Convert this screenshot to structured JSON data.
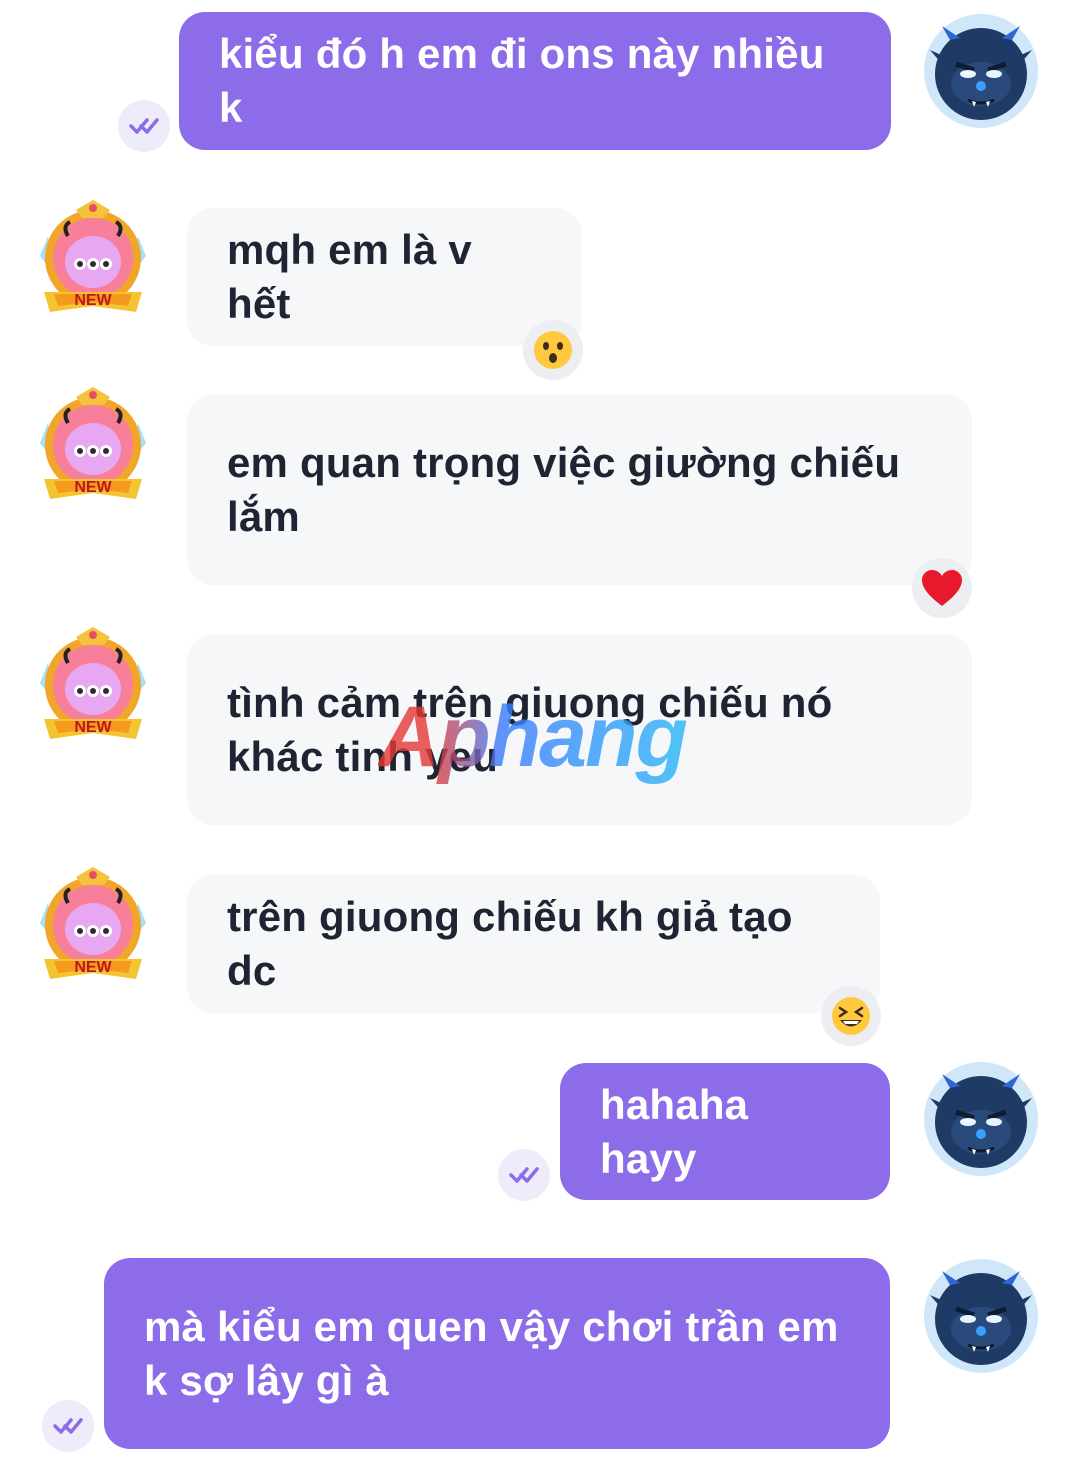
{
  "messages": [
    {
      "text": "kiểu đó h em đi ons này nhiều k",
      "dir": "out"
    },
    {
      "text": "mqh em là v hết",
      "dir": "in",
      "reaction": "surprised-face"
    },
    {
      "text": "em quan trọng việc giường chiếu lắm",
      "dir": "in",
      "reaction": "red-heart"
    },
    {
      "text": "tình cảm trên giuong chiếu nó khác tinh yeu",
      "dir": "in"
    },
    {
      "text": "trên giuong chiếu kh giả tạo dc",
      "dir": "in",
      "reaction": "laughing-face"
    },
    {
      "text": "hahaha hayy",
      "dir": "out"
    },
    {
      "text": "mà kiểu em quen vậy chơi trần em k sợ lây gì à",
      "dir": "out"
    }
  ],
  "watermark": {
    "text": "Aphang"
  },
  "colors": {
    "outgoing_bubble": "#8c6ce9",
    "incoming_bubble": "#f6f7f9",
    "outgoing_text": "#ffffff",
    "incoming_text": "#1f2433"
  },
  "icons": {
    "read_receipt": "double-check-icon",
    "my_avatar": "blue-monster-avatar",
    "peer_avatar": "new-badge-pink-monster-avatar"
  }
}
